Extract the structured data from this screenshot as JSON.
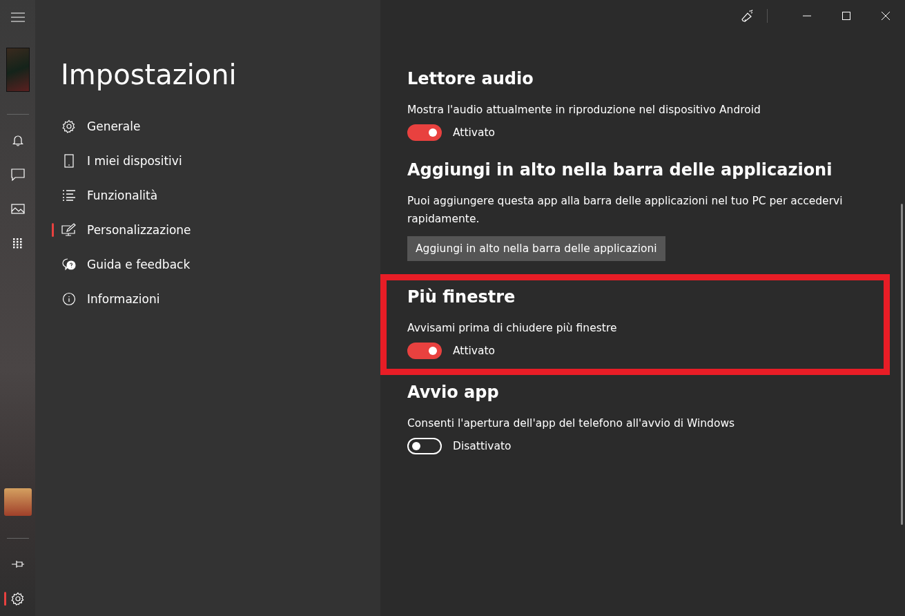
{
  "rail": {
    "items": [
      {
        "selected": false
      },
      {
        "selected": false
      },
      {
        "selected": false
      },
      {
        "selected": false
      }
    ],
    "bottom": [
      {
        "selected": false
      },
      {
        "selected": true
      }
    ]
  },
  "sidebar": {
    "title": "Impostazioni",
    "items": [
      {
        "label": "Generale",
        "selected": false
      },
      {
        "label": "I miei dispositivi",
        "selected": false
      },
      {
        "label": "Funzionalità",
        "selected": false
      },
      {
        "label": "Personalizzazione",
        "selected": true
      },
      {
        "label": "Guida e feedback",
        "selected": false
      },
      {
        "label": "Informazioni",
        "selected": false
      }
    ]
  },
  "sections": [
    {
      "kind": "toggle",
      "title": "Lettore audio",
      "description": "Mostra l'audio attualmente in riproduzione nel dispositivo Android",
      "on": true,
      "state_label": "Attivato",
      "highlighted": false
    },
    {
      "kind": "button",
      "title": "Aggiungi in alto nella barra delle applicazioni",
      "description": "Puoi aggiungere questa app alla barra delle applicazioni nel tuo PC per accedervi rapidamente.",
      "button": "Aggiungi in alto nella barra delle applicazioni",
      "highlighted": false
    },
    {
      "kind": "toggle",
      "title": "Più finestre",
      "description": "Avvisami prima di chiudere più finestre",
      "on": true,
      "state_label": "Attivato",
      "highlighted": true
    },
    {
      "kind": "toggle",
      "title": "Avvio app",
      "description": "Consenti l'apertura dell'app del telefono all'avvio di Windows",
      "on": false,
      "state_label": "Disattivato",
      "highlighted": false
    }
  ]
}
